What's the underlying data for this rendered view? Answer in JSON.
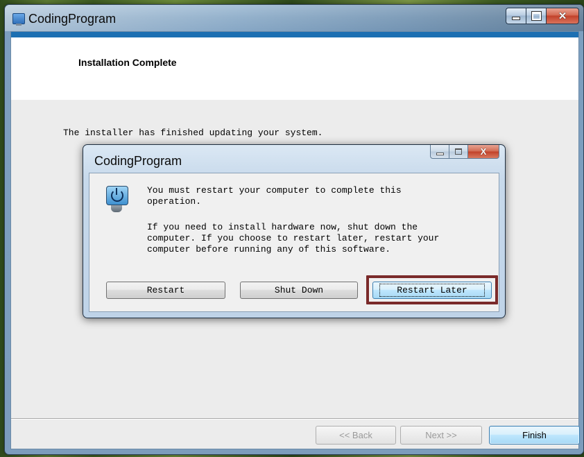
{
  "window": {
    "title": "CodingProgram",
    "header_title": "Installation Complete",
    "message": "The installer has finished updating your system.",
    "nav": {
      "back_label": "<< Back",
      "next_label": "Next >>",
      "finish_label": "Finish"
    }
  },
  "dialog": {
    "title": "CodingProgram",
    "message1": "You must restart your computer to complete this\noperation.",
    "message2": "If you need to install hardware now, shut down the\ncomputer. If you choose to restart later, restart your\ncomputer before running any of this software.",
    "buttons": {
      "restart": "Restart",
      "shut_down": "Shut Down",
      "restart_later": "Restart Later"
    }
  },
  "icons": {
    "app": "installer-app-icon",
    "dialog": "power-restart-icon"
  },
  "colors": {
    "header_strip": "#1c6fb2",
    "highlight_box": "#7a2a2a"
  }
}
